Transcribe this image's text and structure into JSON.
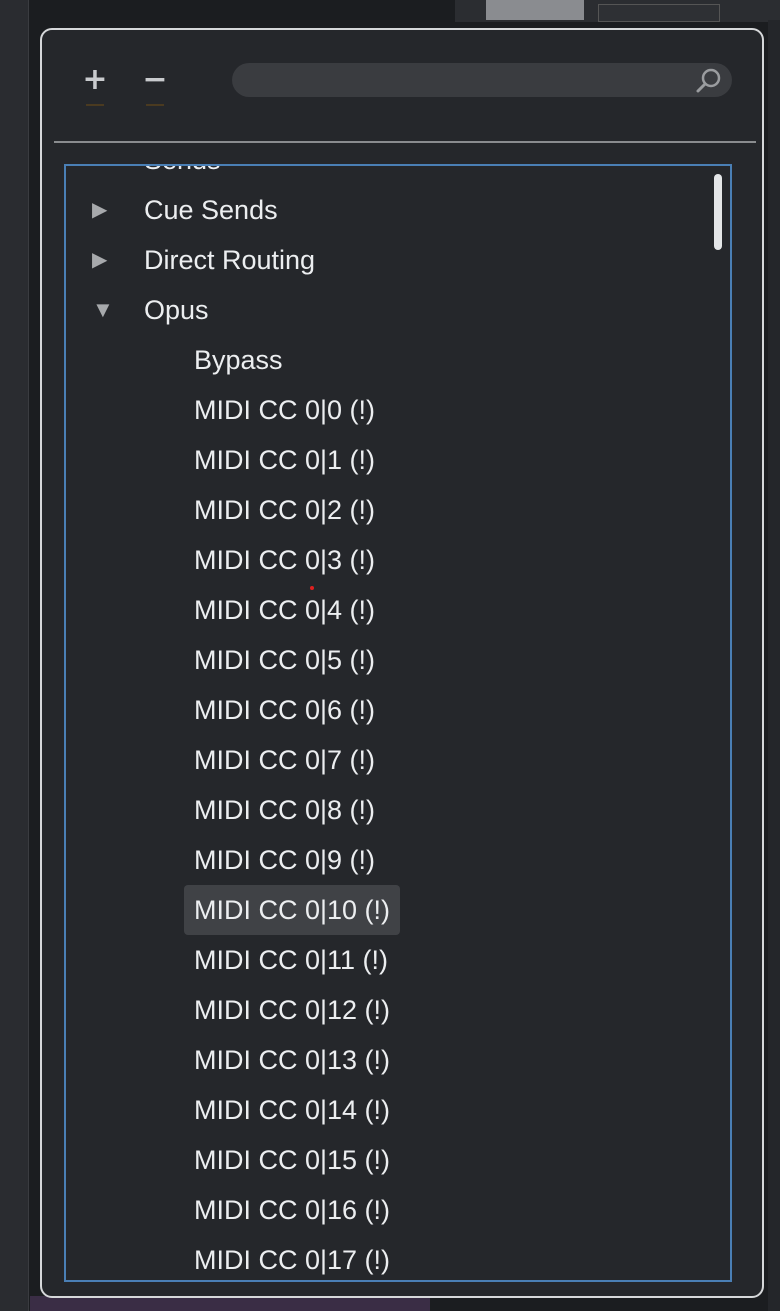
{
  "toolbar": {
    "add_label": "+",
    "remove_label": "−",
    "search_placeholder": "",
    "search_value": ""
  },
  "tree": {
    "partial_top": "Sends",
    "groups": [
      {
        "label": "Cue Sends",
        "expanded": false
      },
      {
        "label": "Direct Routing",
        "expanded": false
      },
      {
        "label": "Opus",
        "expanded": true
      }
    ],
    "opus_items": [
      "Bypass",
      "MIDI CC 0|0 (!)",
      "MIDI CC 0|1 (!)",
      "MIDI CC 0|2 (!)",
      "MIDI CC 0|3 (!)",
      "MIDI CC 0|4 (!)",
      "MIDI CC 0|5 (!)",
      "MIDI CC 0|6 (!)",
      "MIDI CC 0|7 (!)",
      "MIDI CC 0|8 (!)",
      "MIDI CC 0|9 (!)",
      "MIDI CC 0|10 (!)",
      "MIDI CC 0|11 (!)",
      "MIDI CC 0|12 (!)",
      "MIDI CC 0|13 (!)",
      "MIDI CC 0|14 (!)",
      "MIDI CC 0|15 (!)",
      "MIDI CC 0|16 (!)",
      "MIDI CC 0|17 (!)"
    ],
    "selected_item": "MIDI CC 0|10 (!)"
  },
  "icons": {
    "collapsed": "triangle-right-icon",
    "expanded": "triangle-down-icon",
    "search": "search-icon"
  },
  "colors": {
    "accent_border": "#4a7fb5",
    "selection_bg": "#404246"
  }
}
